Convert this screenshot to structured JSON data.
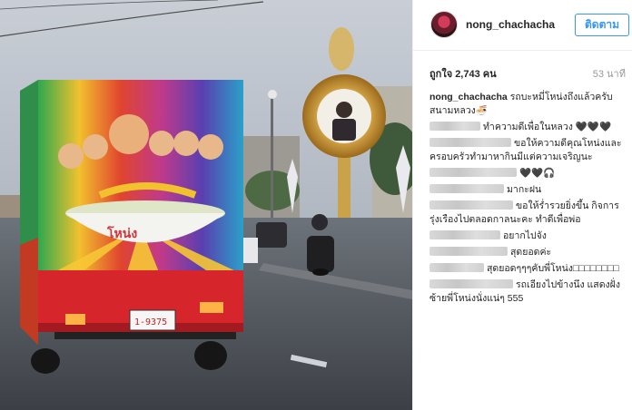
{
  "post": {
    "username": "nong_chachacha",
    "follow_label": "ติดตาม",
    "likes": "ถูกใจ 2,743 คน",
    "time": "53 นาที"
  },
  "truck": {
    "sign_text": "โหน่ง",
    "plate": "1-9375"
  },
  "comments": [
    {
      "user": "nong_chachacha",
      "text": "รถบะหมี่โหน่งถึงแล้วครับ สนามหลวง🍜",
      "blurred": false
    },
    {
      "user": "",
      "text": "ทำความดีเพื่อในหลวง 🖤🖤🖤",
      "blurred": true,
      "bw": 56
    },
    {
      "user": "",
      "text": "ขอให้ความดีคุณโหน่งและครอบครัวทำมาหากินมีแต่ความเจริญนะ",
      "blurred": true,
      "bw": 90
    },
    {
      "user": "",
      "text": "🖤🖤🎧",
      "blurred": true,
      "bw": 96
    },
    {
      "user": "",
      "text": "มากะฝน",
      "blurred": true,
      "bw": 82
    },
    {
      "user": "",
      "text": "ขอให้ร่ำรวยยิ่งขึ้น กิจการรุ่งเรืองไปตลอดกาลนะคะ ทำดีเพื่อพ่อ",
      "blurred": true,
      "bw": 92
    },
    {
      "user": "",
      "text": "อยากไปจัง",
      "blurred": true,
      "bw": 78
    },
    {
      "user": "",
      "text": "สุดยอดค่ะ",
      "blurred": true,
      "bw": 86
    },
    {
      "user": "",
      "text": "สุดยอดๆๆๆคับพี่โหน่ง□□□□□□□□",
      "blurred": true,
      "bw": 60
    },
    {
      "user": "",
      "text": "รถเอียงไปข้างนึง แสดงฝั่งซ้ายพี่โหน่งนั่งแน่ๆ 555",
      "blurred": true,
      "bw": 92
    }
  ]
}
